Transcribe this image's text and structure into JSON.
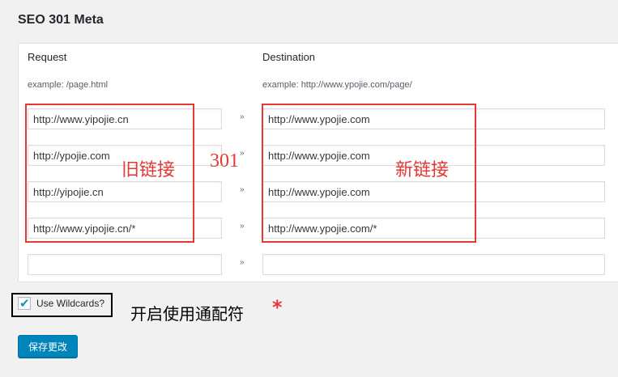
{
  "section": {
    "title": "SEO 301 Meta"
  },
  "columns": {
    "request_header": "Request",
    "destination_header": "Destination",
    "request_example": "example: /page.html",
    "destination_example": "example: http://www.ypojie.com/page/"
  },
  "redirects": [
    {
      "request": "http://www.yipojie.cn",
      "destination": "http://www.ypojie.com"
    },
    {
      "request": "http://ypojie.com",
      "destination": "http://www.ypojie.com"
    },
    {
      "request": "http://yipojie.cn",
      "destination": "http://www.ypojie.com"
    },
    {
      "request": "http://www.yipojie.cn/*",
      "destination": "http://www.ypojie.com/*"
    },
    {
      "request": "",
      "destination": ""
    }
  ],
  "arrow_symbol": "»",
  "annotations": {
    "old_link": "旧链接",
    "new_link": "新链接",
    "code": "301",
    "enable_note": "开启使用通配符",
    "asterisk": "*",
    "highlight_color": "#e53935"
  },
  "wildcards": {
    "label": "Use Wildcards?",
    "checked": true
  },
  "save_button": {
    "label": "保存更改",
    "color": "#0085ba"
  }
}
